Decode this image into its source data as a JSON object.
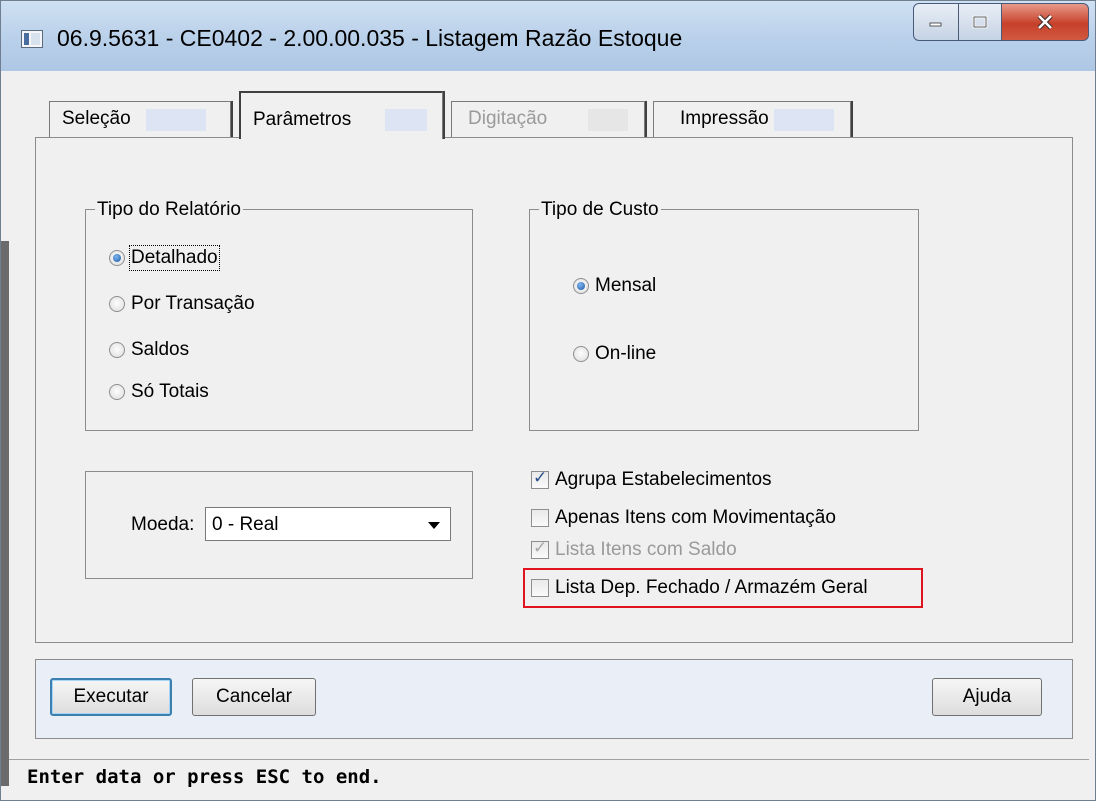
{
  "window": {
    "title": "06.9.5631 - CE0402 - 2.00.00.035 - Listagem Razão Estoque"
  },
  "tabs": [
    {
      "label": "Seleção",
      "state": "normal"
    },
    {
      "label": "Parâmetros",
      "state": "selected"
    },
    {
      "label": "Digitação",
      "state": "disabled"
    },
    {
      "label": "Impressão",
      "state": "normal"
    }
  ],
  "tipo_relatorio": {
    "title": "Tipo do Relatório",
    "options": [
      "Detalhado",
      "Por Transação",
      "Saldos",
      "Só Totais"
    ],
    "selected": "Detalhado"
  },
  "tipo_custo": {
    "title": "Tipo de Custo",
    "options": [
      "Mensal",
      "On-line"
    ],
    "selected": "Mensal"
  },
  "moeda": {
    "label": "Moeda:",
    "value": "0 - Real"
  },
  "checkboxes": [
    {
      "label": "Agrupa Estabelecimentos",
      "checked": true,
      "disabled": false
    },
    {
      "label": "Apenas Itens com Movimentação",
      "checked": false,
      "disabled": false
    },
    {
      "label": "Lista Itens com Saldo",
      "checked": true,
      "disabled": true
    },
    {
      "label": "Lista Dep. Fechado / Armazém Geral",
      "checked": false,
      "disabled": false,
      "highlighted": true
    }
  ],
  "buttons": {
    "execute": "Executar",
    "cancel": "Cancelar",
    "help": "Ajuda"
  },
  "status_text": "Enter data or press ESC to end.",
  "colors": {
    "highlight": "#e0141e",
    "radio_selected": "#1b5aa8"
  }
}
